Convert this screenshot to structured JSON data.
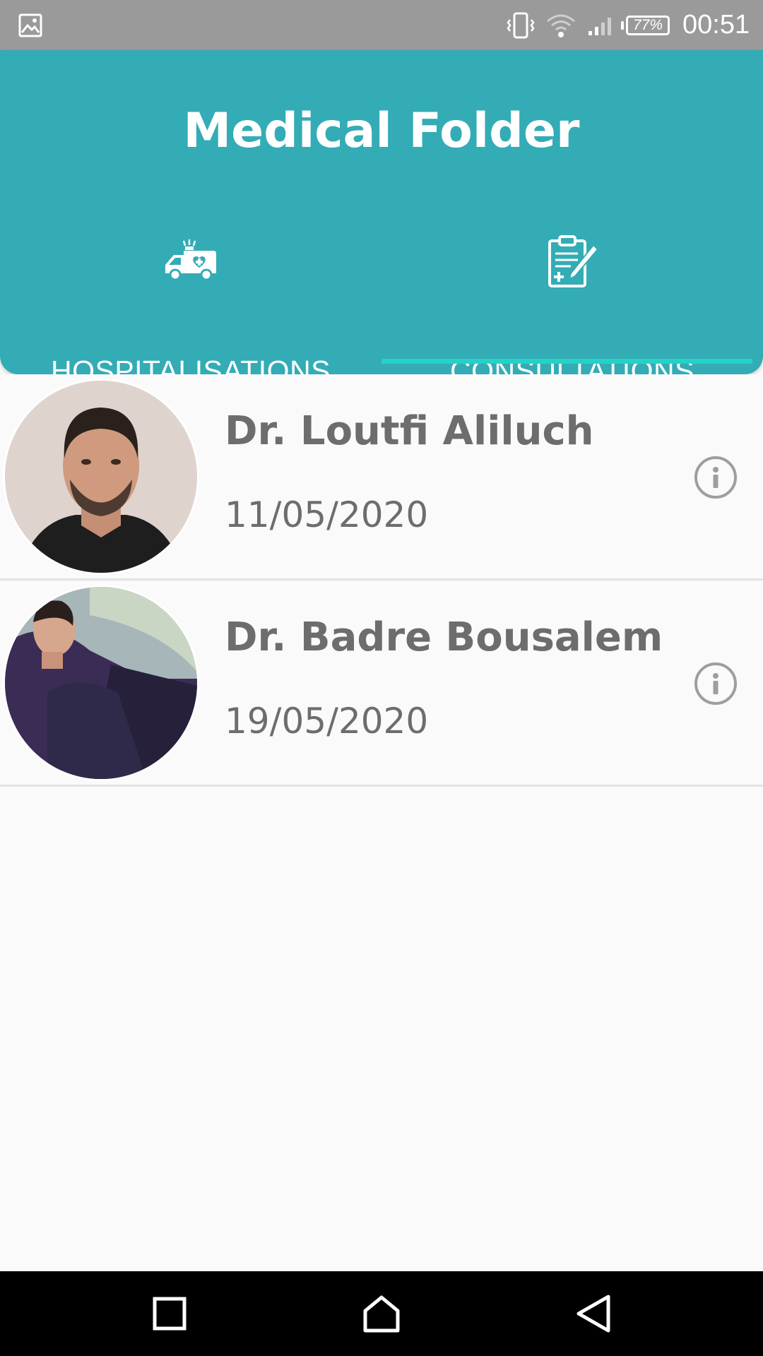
{
  "status_bar": {
    "time": "00:51",
    "battery": "77%",
    "icons": [
      "image-icon",
      "vibrate-icon",
      "wifi-icon",
      "signal-icon",
      "battery-icon"
    ]
  },
  "header": {
    "title": "Medical Folder",
    "accent_color": "#33acb6",
    "indicator_color": "#25d2c6",
    "tabs": [
      {
        "label": "HOSPITALISATIONS",
        "icon": "ambulance-icon",
        "selected": false
      },
      {
        "label": "CONSULTATIONS",
        "icon": "clipboard-prescription-icon",
        "selected": true
      }
    ]
  },
  "consultations": [
    {
      "doctor": "Dr. Loutfi Aliluch",
      "date": "11/05/2020",
      "avatar": "doctor-photo",
      "action_icon": "info-icon"
    },
    {
      "doctor": "Dr. Badre Bousalem",
      "date": "19/05/2020",
      "avatar": "doctor-photo",
      "action_icon": "info-icon"
    }
  ],
  "nav_bar": {
    "buttons": [
      "recents-icon",
      "home-icon",
      "back-icon"
    ]
  }
}
